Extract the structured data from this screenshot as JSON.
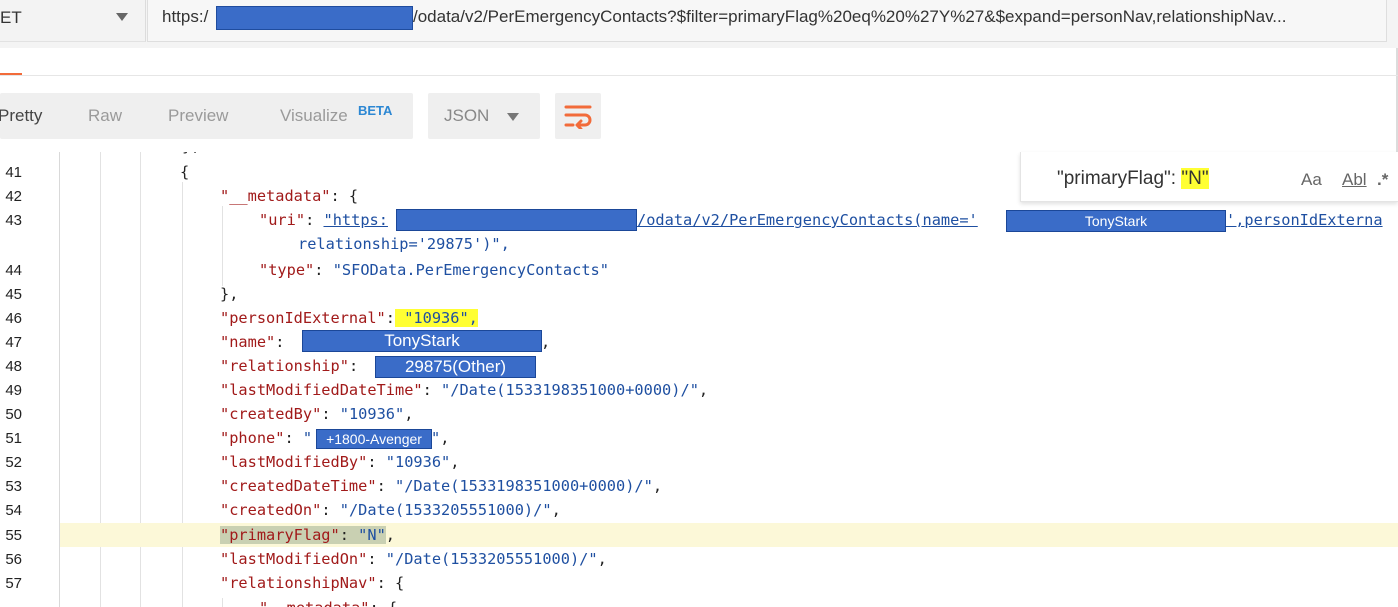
{
  "request": {
    "method": "ET",
    "url_prefix": "https:/",
    "url_rest": "/odata/v2/PerEmergencyContacts?$filter=primaryFlag%20eq%20%27Y%27&$expand=personNav,relationshipNav..."
  },
  "response_tabs": {
    "pretty": "Pretty",
    "raw": "Raw",
    "preview": "Preview",
    "visualize": "Visualize",
    "visualize_badge": "BETA"
  },
  "format": {
    "selected": "JSON"
  },
  "search": {
    "query_before": "\"primaryFlag\": ",
    "query_hit": "\"N\"",
    "opt_case": "Aa",
    "opt_word": "Abl",
    "opt_regex": ".*"
  },
  "code": {
    "line_numbers": [
      "41",
      "42",
      "43",
      "44",
      "45",
      "46",
      "47",
      "48",
      "49",
      "50",
      "51",
      "52",
      "53",
      "54",
      "55",
      "56",
      "57"
    ],
    "l41": "{",
    "l42_key": "\"__metadata\"",
    "l42_rest": ": {",
    "l43_key": "\"uri\"",
    "l43_colon": ": ",
    "l43_uri_start": "\"https:",
    "l43_uri_mid": "/odata/v2/PerEmergencyContacts(name='",
    "l43_uri_end": "',personIdExterna",
    "l43_redact_name": "TonyStark",
    "l43b": "relationship='29875')\",",
    "l44_key": "\"type\"",
    "l44_colon": ": ",
    "l44_val": "\"SFOData.PerEmergencyContacts\"",
    "l45": "},",
    "l46_key": "\"personIdExternal\"",
    "l46_colon": ":",
    "l46_val": " \"10936\",",
    "l47_key": "\"name\"",
    "l47_colon": ":",
    "l47_redact": "TonyStark",
    "l47_end": ",",
    "l48_key": "\"relationship\"",
    "l48_colon": ":",
    "l48_redact": "29875(Other)",
    "l49_key": "\"lastModifiedDateTime\"",
    "l49_colon": ": ",
    "l49_val": "\"/Date(1533198351000+0000)/\"",
    "l49_end": ",",
    "l50_key": "\"createdBy\"",
    "l50_colon": ": ",
    "l50_val": "\"10936\"",
    "l50_end": ",",
    "l51_key": "\"phone\"",
    "l51_colon": ": ",
    "l51_q1": "\"",
    "l51_redact": "+1800-Avenger",
    "l51_q2": "\"",
    "l51_end": ",",
    "l52_key": "\"lastModifiedBy\"",
    "l52_colon": ": ",
    "l52_val": "\"10936\"",
    "l52_end": ",",
    "l53_key": "\"createdDateTime\"",
    "l53_colon": ": ",
    "l53_val": "\"/Date(1533198351000+0000)/\"",
    "l53_end": ",",
    "l54_key": "\"createdOn\"",
    "l54_colon": ": ",
    "l54_val": "\"/Date(1533205551000)/\"",
    "l54_end": ",",
    "l55_key": "\"primaryFlag\"",
    "l55_colon": ": ",
    "l55_val": "\"N\"",
    "l55_end": ",",
    "l56_key": "\"lastModifiedOn\"",
    "l56_colon": ": ",
    "l56_val": "\"/Date(1533205551000)/\"",
    "l56_end": ",",
    "l57_key": "\"relationshipNav\"",
    "l57_colon": ": {",
    "l58_key": "\"__metadata\"",
    "l58_colon": ": {"
  },
  "colors": {
    "key": "#a11a1a",
    "string": "#1e4fa1",
    "highlight": "#ffff33",
    "redaction": "#3a6cc8",
    "accent": "#f26b3a",
    "beta": "#2c87d3"
  }
}
